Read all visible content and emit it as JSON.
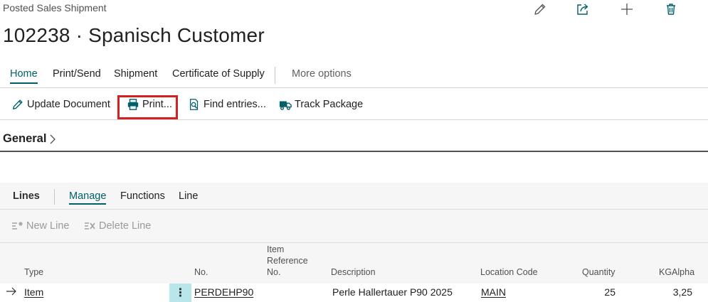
{
  "page": {
    "caption": "Posted Sales Shipment",
    "title": "102238 · Spanisch Customer"
  },
  "top_actions": {
    "edit_icon": "pencil-icon",
    "share_icon": "share-icon",
    "new_icon": "plus-icon",
    "delete_icon": "trash-icon"
  },
  "menu": {
    "tabs": [
      {
        "label": "Home"
      },
      {
        "label": "Print/Send"
      },
      {
        "label": "Shipment"
      },
      {
        "label": "Certificate of Supply"
      }
    ],
    "more": "More options"
  },
  "toolbar": {
    "update_document": "Update Document",
    "print": "Print...",
    "find_entries": "Find entries...",
    "track_package": "Track Package"
  },
  "general": {
    "label": "General"
  },
  "lines": {
    "title": "Lines",
    "tabs": [
      {
        "label": "Manage"
      },
      {
        "label": "Functions"
      },
      {
        "label": "Line"
      }
    ],
    "new_line": "New Line",
    "delete_line": "Delete Line",
    "columns": {
      "type": "Type",
      "no": "No.",
      "item_ref_1": "Item",
      "item_ref_2": "Reference",
      "item_ref_3": "No.",
      "description": "Description",
      "location_code": "Location Code",
      "quantity": "Quantity",
      "kgalpha": "KGAlpha"
    },
    "rows": [
      {
        "type": "Item",
        "no": "PERDEHP90",
        "item_ref": "",
        "description": "Perle Hallertauer P90 2025",
        "location_code": "MAIN",
        "quantity": "25",
        "kgalpha": "3,25"
      }
    ]
  },
  "colors": {
    "accent": "#00606a",
    "highlight_box": "#d42020",
    "selected_cell": "#b9e6ea"
  }
}
